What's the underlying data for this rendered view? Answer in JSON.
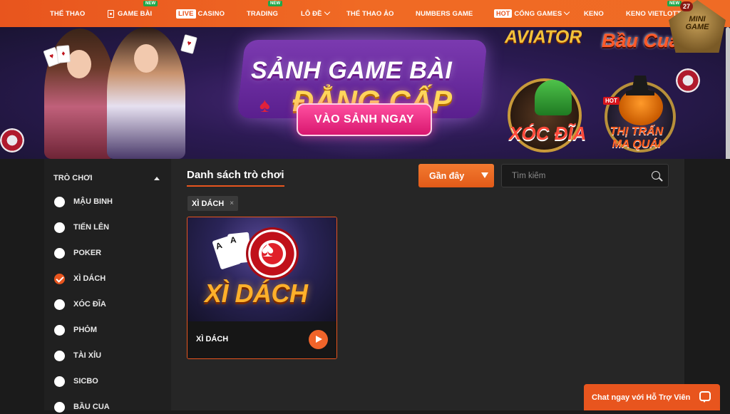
{
  "nav": {
    "items": [
      {
        "label": "THỂ THAO"
      },
      {
        "label": "GAME BÀI",
        "badge": "NEW"
      },
      {
        "tag": "LIVE",
        "label": "CASINO"
      },
      {
        "label": "TRADING",
        "badge": "NEW"
      },
      {
        "label": "LÔ ĐỀ"
      },
      {
        "label": "THỂ THAO ẢO"
      },
      {
        "label": "NUMBERS GAME"
      },
      {
        "tag": "HOT",
        "label": "CỔNG GAMES"
      },
      {
        "label": "KENO"
      },
      {
        "label": "KENO VIETLOTT",
        "badge": "NEW"
      }
    ]
  },
  "mini_game": {
    "count": "27",
    "label": "MINI GAME"
  },
  "banner": {
    "title_line1": "SẢNH GAME BÀI",
    "title_line2": "ĐẲNG CẤP",
    "cta": "VÀO SẢNH NGAY",
    "games": {
      "aviator": "AVIATOR",
      "baucua": "Bầu Cua",
      "xocdia": "XÓC ĐĨA",
      "thitran": "THỊ TRẤN MA QUÁI",
      "hot": "HOT"
    }
  },
  "sidebar": {
    "heading": "TRÒ CHƠI",
    "items": [
      {
        "label": "MẬU BINH",
        "checked": false
      },
      {
        "label": "TIẾN LÊN",
        "checked": false
      },
      {
        "label": "POKER",
        "checked": false
      },
      {
        "label": "XÌ DÁCH",
        "checked": true
      },
      {
        "label": "XÓC ĐĨA",
        "checked": false
      },
      {
        "label": "PHỎM",
        "checked": false
      },
      {
        "label": "TÀI XỈU",
        "checked": false
      },
      {
        "label": "SICBO",
        "checked": false
      },
      {
        "label": "BẦU CUA",
        "checked": false
      }
    ]
  },
  "main": {
    "title": "Danh sách trò chơi",
    "sort_label": "Gần đây",
    "search_placeholder": "Tìm kiếm",
    "active_filter": "XÌ DÁCH",
    "active_filter_close": "×",
    "game": {
      "art_title": "XÌ DÁCH",
      "name": "XÌ DÁCH",
      "card_rank": "A"
    }
  },
  "chat": {
    "label": "Chat ngay với Hỗ Trợ Viên"
  },
  "colors": {
    "accent": "#e8551e",
    "sidebar_bg": "#202020",
    "main_bg": "#262626"
  }
}
